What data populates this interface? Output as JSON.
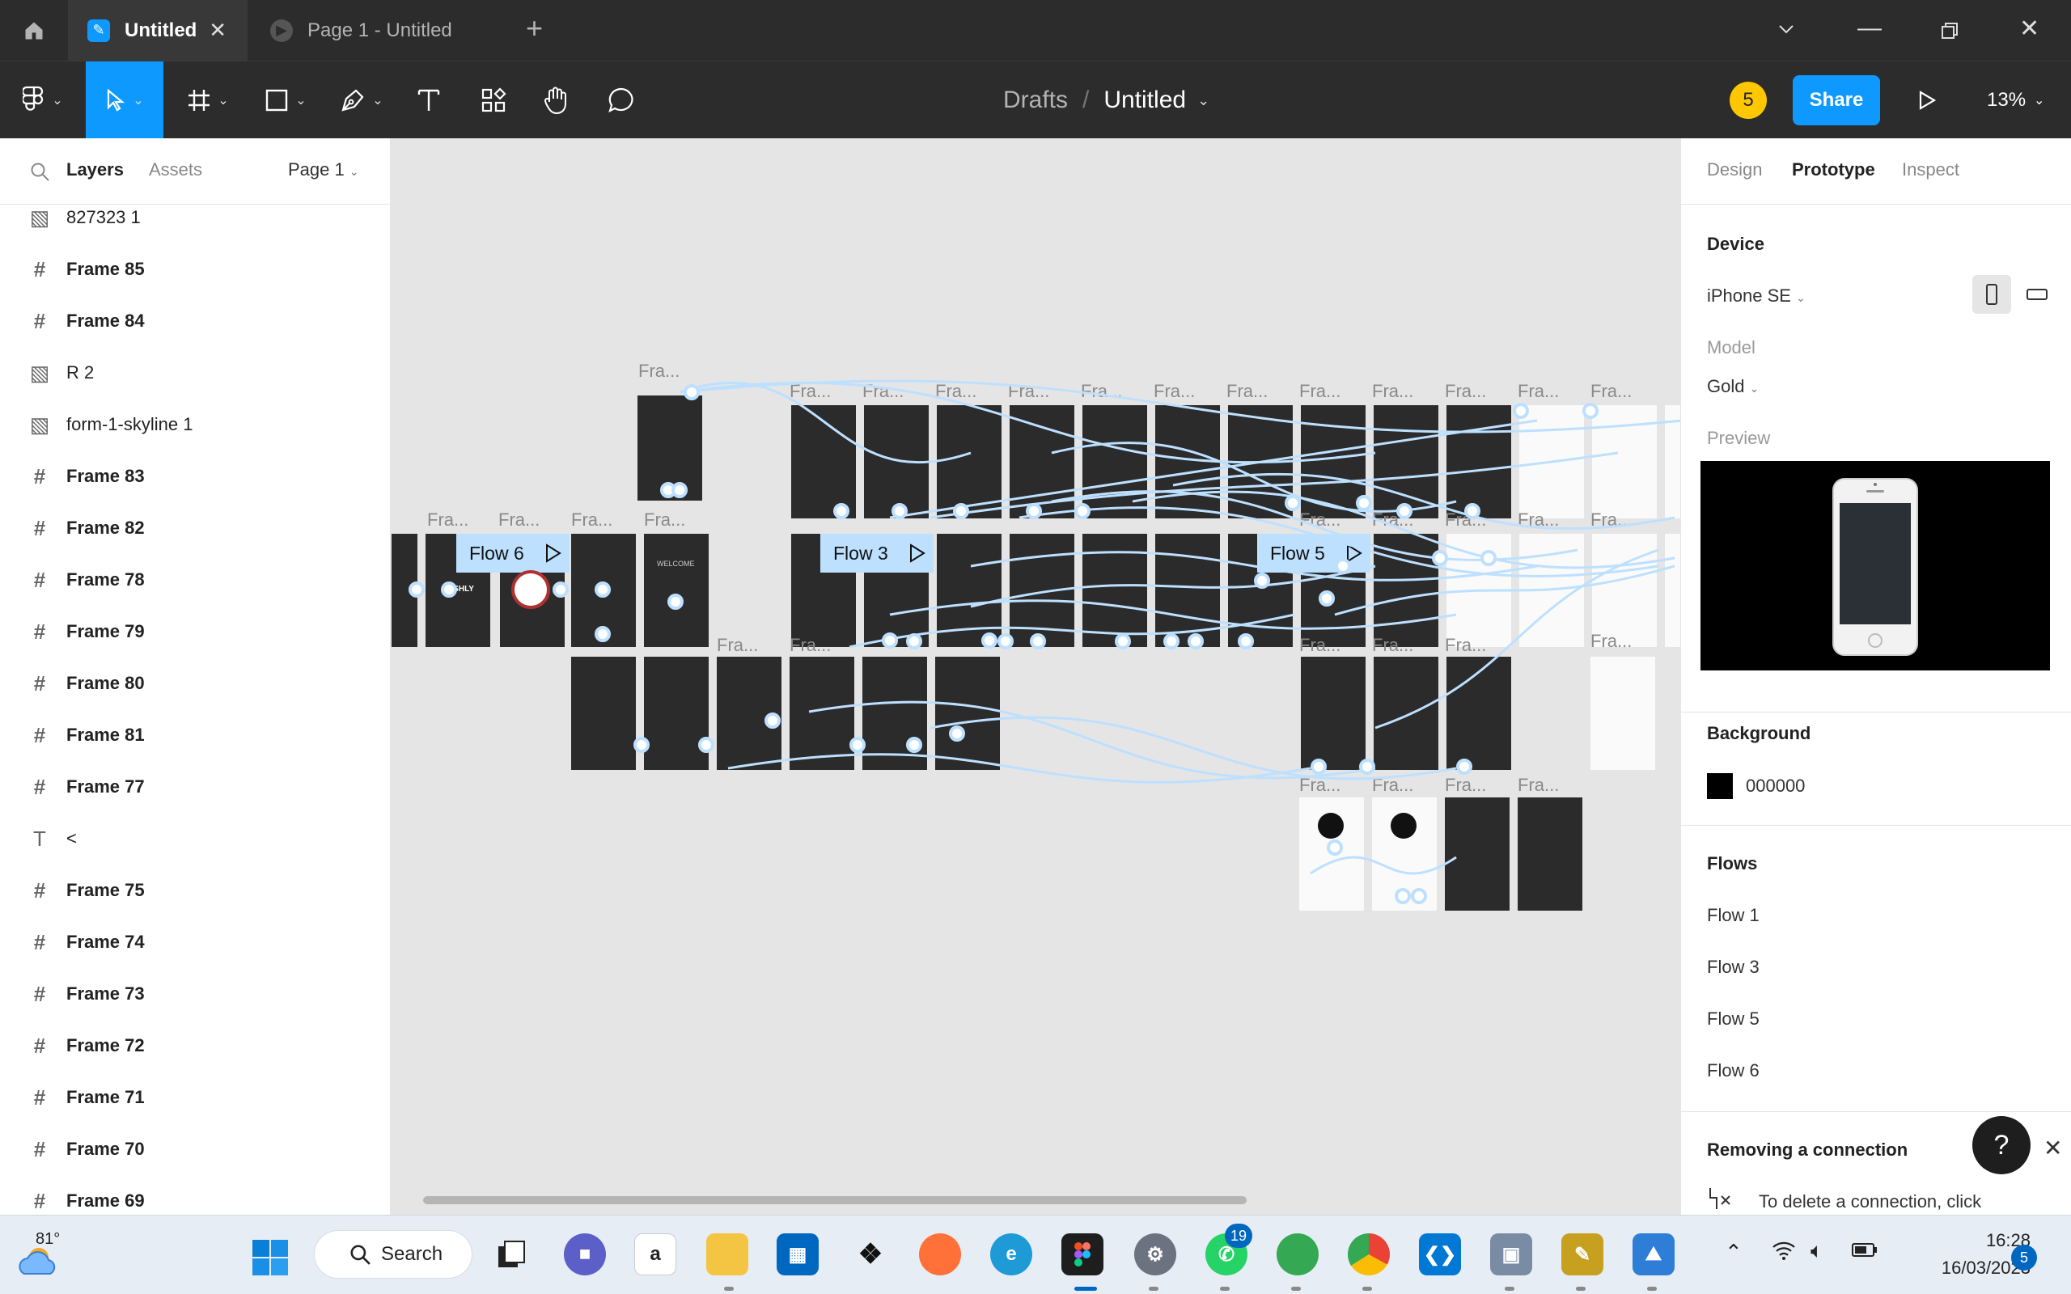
{
  "tabs": [
    {
      "label": "Untitled",
      "active": true
    },
    {
      "label": "Page 1 - Untitled",
      "active": false
    }
  ],
  "toolbar": {
    "breadcrumb_parent": "Drafts",
    "breadcrumb_sep": "/",
    "file_name": "Untitled",
    "avatar": "5",
    "share_label": "Share",
    "zoom": "13%"
  },
  "left_panel": {
    "tab_layers": "Layers",
    "tab_assets": "Assets",
    "page": "Page 1",
    "layers": [
      {
        "name": "827323 1",
        "type": "image",
        "bold": false
      },
      {
        "name": "Frame 85",
        "type": "frame",
        "bold": true
      },
      {
        "name": "Frame 84",
        "type": "frame",
        "bold": true
      },
      {
        "name": "R 2",
        "type": "image",
        "bold": false
      },
      {
        "name": "form-1-skyline 1",
        "type": "image",
        "bold": false
      },
      {
        "name": "Frame 83",
        "type": "frame",
        "bold": true
      },
      {
        "name": "Frame 82",
        "type": "frame",
        "bold": true
      },
      {
        "name": "Frame 78",
        "type": "frame",
        "bold": true
      },
      {
        "name": "Frame 79",
        "type": "frame",
        "bold": true
      },
      {
        "name": "Frame 80",
        "type": "frame",
        "bold": true
      },
      {
        "name": "Frame 81",
        "type": "frame",
        "bold": true
      },
      {
        "name": "Frame 77",
        "type": "frame",
        "bold": true
      },
      {
        "name": "<",
        "type": "text",
        "bold": false
      },
      {
        "name": "Frame 75",
        "type": "frame",
        "bold": true
      },
      {
        "name": "Frame 74",
        "type": "frame",
        "bold": true
      },
      {
        "name": "Frame 73",
        "type": "frame",
        "bold": true
      },
      {
        "name": "Frame 72",
        "type": "frame",
        "bold": true
      },
      {
        "name": "Frame 71",
        "type": "frame",
        "bold": true
      },
      {
        "name": "Frame 70",
        "type": "frame",
        "bold": true
      },
      {
        "name": "Frame 69",
        "type": "frame",
        "bold": true
      }
    ]
  },
  "canvas": {
    "frame_label": "Fra...",
    "flows": [
      "Flow 6",
      "Flow 3",
      "Flow 5"
    ],
    "frame_texts": {
      "wishly": "WISHLY",
      "welcome": "WELCOME"
    }
  },
  "right_panel": {
    "tab_design": "Design",
    "tab_prototype": "Prototype",
    "tab_inspect": "Inspect",
    "device_title": "Device",
    "device": "iPhone SE",
    "model_label": "Model",
    "model": "Gold",
    "preview_label": "Preview",
    "background_title": "Background",
    "background_hex": "000000",
    "flows_title": "Flows",
    "flows": [
      "Flow 1",
      "Flow 3",
      "Flow 5",
      "Flow 6"
    ],
    "removing_title": "Removing a connection",
    "removing_text": "To delete a connection, click",
    "help": "?"
  },
  "taskbar": {
    "temperature": "81°",
    "search_label": "Search",
    "whatsapp_badge": "19",
    "time": "16:28",
    "date": "16/03/2023",
    "notifications": "5"
  },
  "colors": {
    "accent": "#0d99ff",
    "flow": "#bde0ff",
    "frame": "#2b2b2b",
    "avatar": "#ffc700"
  }
}
